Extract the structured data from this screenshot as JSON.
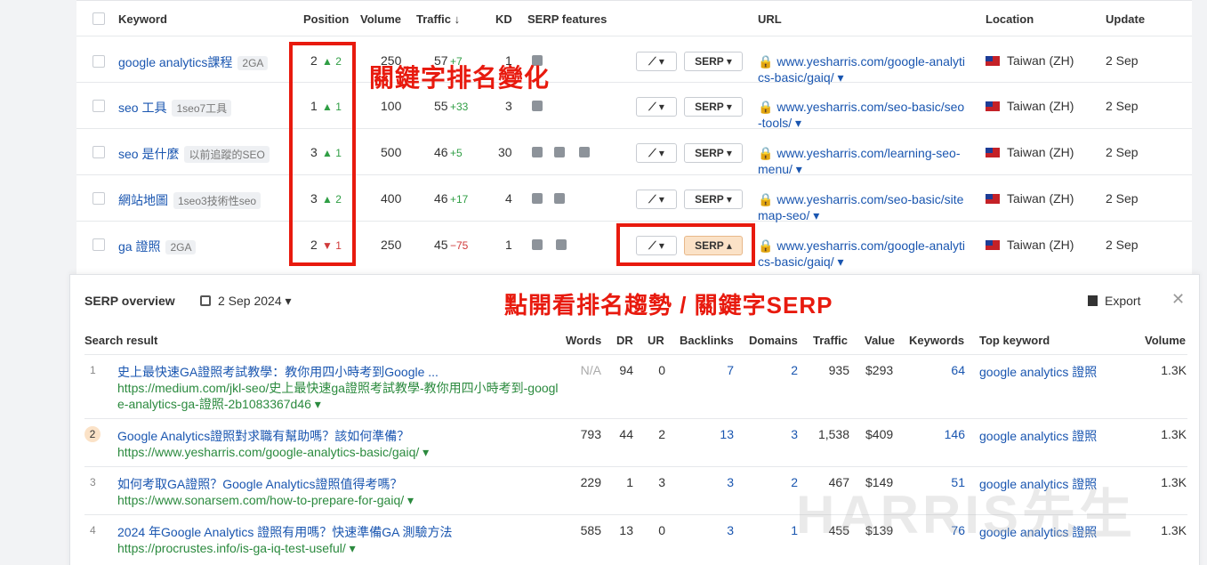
{
  "table": {
    "headers": {
      "keyword": "Keyword",
      "position": "Position",
      "volume": "Volume",
      "traffic": "Traffic ↓",
      "kd": "KD",
      "serp_features": "SERP features",
      "url": "URL",
      "location": "Location",
      "update": "Update"
    },
    "rows": [
      {
        "keyword": "google analytics課程",
        "tag": "2GA",
        "position": "2",
        "pos_change": "▲ 2",
        "pos_dir": "up",
        "volume": "250",
        "traffic": "57",
        "traffic_change": "+7",
        "kd": "1",
        "serp_btn": "SERP ▾",
        "url_line1": "www.yesharris.com/google-analyti",
        "url_line2": "cs-basic/gaiq/ ▾",
        "location": "Taiwan (ZH)",
        "update": "2 Sep"
      },
      {
        "keyword": "seo 工具",
        "tag": "1seo7工具",
        "position": "1",
        "pos_change": "▲ 1",
        "pos_dir": "up",
        "volume": "100",
        "traffic": "55",
        "traffic_change": "+33",
        "kd": "3",
        "serp_btn": "SERP ▾",
        "url_line1": "www.yesharris.com/seo-basic/seo",
        "url_line2": "-tools/ ▾",
        "location": "Taiwan (ZH)",
        "update": "2 Sep"
      },
      {
        "keyword": "seo 是什麼",
        "tag": "以前追蹤的SEO",
        "position": "3",
        "pos_change": "▲ 1",
        "pos_dir": "up",
        "volume": "500",
        "traffic": "46",
        "traffic_change": "+5",
        "kd": "30",
        "serp_btn": "SERP ▾",
        "url_line1": "www.yesharris.com/learning-seo-",
        "url_line2": "menu/ ▾",
        "location": "Taiwan (ZH)",
        "update": "2 Sep"
      },
      {
        "keyword": "網站地圖",
        "tag": "1seo3技術性seo",
        "position": "3",
        "pos_change": "▲ 2",
        "pos_dir": "up",
        "volume": "400",
        "traffic": "46",
        "traffic_change": "+17",
        "kd": "4",
        "serp_btn": "SERP ▾",
        "url_line1": "www.yesharris.com/seo-basic/site",
        "url_line2": "map-seo/ ▾",
        "location": "Taiwan (ZH)",
        "update": "2 Sep"
      },
      {
        "keyword": "ga 證照",
        "tag": "2GA",
        "position": "2",
        "pos_change": "▼ 1",
        "pos_dir": "down",
        "volume": "250",
        "traffic": "45",
        "traffic_change": "−75",
        "kd": "1",
        "serp_btn": "SERP ▴",
        "url_line1": "www.yesharris.com/google-analyti",
        "url_line2": "cs-basic/gaiq/ ▾",
        "location": "Taiwan (ZH)",
        "update": "2 Sep"
      }
    ],
    "chart_btn": "⟋ ▾"
  },
  "annotations": {
    "rank_change": "關鍵字排名變化",
    "serp_open": "點開看排名趨勢 / 關鍵字SERP"
  },
  "serp": {
    "title": "SERP overview",
    "date": "2 Sep 2024 ▾",
    "export": "Export",
    "close": "✕",
    "headers": {
      "result": "Search result",
      "words": "Words",
      "dr": "DR",
      "ur": "UR",
      "backlinks": "Backlinks",
      "domains": "Domains",
      "traffic": "Traffic",
      "value": "Value",
      "keywords": "Keywords",
      "top_keyword": "Top keyword",
      "volume": "Volume"
    },
    "results": [
      {
        "rank": "1",
        "title": "史上最快速GA證照考試教學：教你用四小時考到Google ...",
        "url": "https://medium.com/jkl-seo/史上最快速ga證照考試教學-教你用四小時考到-google-analytics-ga-證照-2b1083367d46 ▾",
        "words": "N/A",
        "dr": "94",
        "ur": "0",
        "backlinks": "7",
        "domains": "2",
        "traffic": "935",
        "value": "$293",
        "keywords": "64",
        "top_keyword": "google analytics 證照",
        "volume": "1.3K"
      },
      {
        "rank": "2",
        "title": "Google Analytics證照對求職有幫助嗎？該如何準備？",
        "url": "https://www.yesharris.com/google-analytics-basic/gaiq/ ▾",
        "words": "793",
        "dr": "44",
        "ur": "2",
        "backlinks": "13",
        "domains": "3",
        "traffic": "1,538",
        "value": "$409",
        "keywords": "146",
        "top_keyword": "google analytics 證照",
        "volume": "1.3K"
      },
      {
        "rank": "3",
        "title": "如何考取GA證照？Google Analytics證照值得考嗎？",
        "url": "https://www.sonarsem.com/how-to-prepare-for-gaiq/ ▾",
        "words": "229",
        "dr": "1",
        "ur": "3",
        "backlinks": "3",
        "domains": "2",
        "traffic": "467",
        "value": "$149",
        "keywords": "51",
        "top_keyword": "google analytics 證照",
        "volume": "1.3K"
      },
      {
        "rank": "4",
        "title": "2024 年Google Analytics 證照有用嗎？快速準備GA 測驗方法",
        "url": "https://procrustes.info/is-ga-iq-test-useful/ ▾",
        "words": "585",
        "dr": "13",
        "ur": "0",
        "backlinks": "3",
        "domains": "1",
        "traffic": "455",
        "value": "$139",
        "keywords": "76",
        "top_keyword": "google analytics 證照",
        "volume": "1.3K"
      }
    ]
  },
  "watermark": "HARRIS先生",
  "colors": {
    "annotation_red": "#e81a0e",
    "link_blue": "#1a56b0",
    "up_green": "#2f9e44",
    "down_red": "#d03a3a",
    "serp_active": "#fbe2c7"
  }
}
